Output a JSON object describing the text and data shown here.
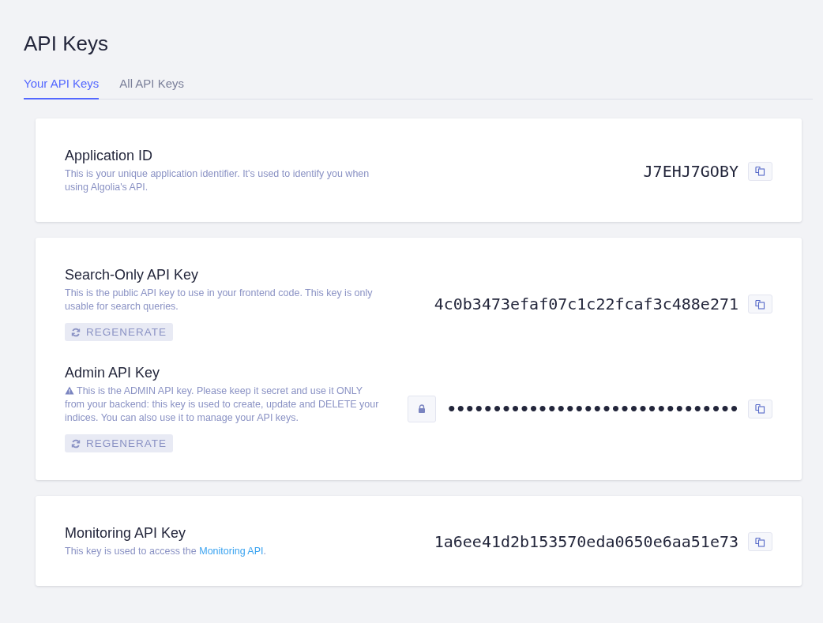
{
  "page": {
    "title": "API Keys"
  },
  "tabs": [
    {
      "label": "Your API Keys",
      "selected": true
    },
    {
      "label": "All API Keys",
      "selected": false
    }
  ],
  "cards": [
    {
      "sections": [
        {
          "title": "Application ID",
          "description": "This is your unique application identifier. It's used to identify you when using Algolia's API.",
          "warning": false,
          "value": "J7EHJ7GOBY",
          "masked": false
        }
      ]
    },
    {
      "sections": [
        {
          "title": "Search-Only API Key",
          "description": "This is the public API key to use in your frontend code. This key is only usable for search queries.",
          "warning": false,
          "value": "4c0b3473efaf07c1c22fcaf3c488e271",
          "masked": false,
          "regenerate_label": "REGENERATE"
        },
        {
          "title": "Admin API Key",
          "description": "This is the ADMIN API key. Please keep it secret and use it ONLY from your backend: this key is used to create, update and DELETE your indices. You can also use it to manage your API keys.",
          "warning": true,
          "value": "••••••••••••••••••••••••••••••••",
          "masked": true,
          "regenerate_label": "REGENERATE"
        }
      ]
    },
    {
      "sections": [
        {
          "title": "Monitoring API Key",
          "description": "This key is used to access the ",
          "link": "Monitoring API",
          "description_end": ".",
          "warning": false,
          "value": "1a6ee41d2b153570eda0650e6aa51e73",
          "masked": false
        }
      ]
    }
  ]
}
